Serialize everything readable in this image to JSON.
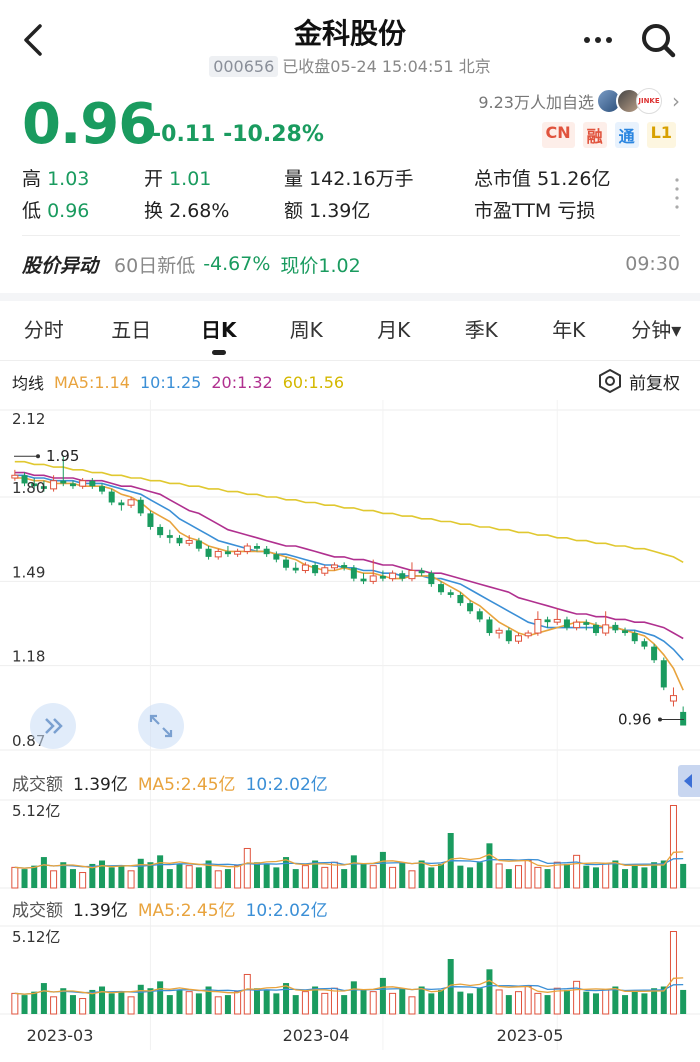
{
  "header": {
    "title": "金科股份",
    "code": "000656",
    "status": "已收盘05-24 15:04:51 北京"
  },
  "follow": {
    "text": "9.23万人加自选",
    "avatar3_text": "JINKE"
  },
  "quote": {
    "price": "0.96",
    "change": "-0.11",
    "change_pct": "-10.28%",
    "badges": [
      "CN",
      "融",
      "通",
      "L1"
    ]
  },
  "stats": {
    "high_label": "高",
    "high_value": "1.03",
    "open_label": "开",
    "open_value": "1.01",
    "vol_label": "量",
    "vol_value": "142.16万手",
    "mktcap_label": "总市值",
    "mktcap_value": "51.26亿",
    "low_label": "低",
    "low_value": "0.96",
    "turnover_label": "换",
    "turnover_value": "2.68%",
    "amount_label": "额",
    "amount_value": "1.39亿",
    "pe_label": "市盈TTM",
    "pe_value": "亏损"
  },
  "abnormal": {
    "label": "股价异动",
    "text": "60日新低",
    "pct": "-4.67%",
    "now": "现价1.02",
    "time": "09:30"
  },
  "tabs": [
    "分时",
    "五日",
    "日K",
    "周K",
    "月K",
    "季K",
    "年K",
    "分钟▾"
  ],
  "ma": {
    "label": "均线",
    "ma5": "MA5:1.14",
    "ma10": "10:1.25",
    "ma20": "20:1.32",
    "ma60": "60:1.56",
    "restore": "前复权",
    "colors": {
      "ma5": "#e8a33d",
      "ma10": "#3b8fd6",
      "ma20": "#b0308f",
      "ma60": "#e0c830"
    }
  },
  "colors": {
    "up": "#e0533d",
    "down": "#1a9b5f"
  },
  "volume": {
    "label": "成交额",
    "value": "1.39亿",
    "ma5": "MA5:2.45亿",
    "ma10": "10:2.02亿",
    "max_label": "5.12亿"
  },
  "chart_data": {
    "type": "candlestick",
    "y_ticks": [
      "2.12",
      "1.80",
      "1.49",
      "1.18",
      "0.87"
    ],
    "ylim": [
      0.87,
      2.12
    ],
    "high_mark": "1.95",
    "low_mark": "0.96",
    "x_ticks": [
      "2023-03",
      "2023-04",
      "2023-05"
    ],
    "candles": [
      [
        1.87,
        1.88,
        1.9,
        1.86
      ],
      [
        1.88,
        1.85,
        1.89,
        1.84
      ],
      [
        1.85,
        1.84,
        1.87,
        1.83
      ],
      [
        1.84,
        1.83,
        1.86,
        1.82
      ],
      [
        1.83,
        1.86,
        1.88,
        1.82
      ],
      [
        1.86,
        1.85,
        1.95,
        1.84
      ],
      [
        1.85,
        1.84,
        1.86,
        1.83
      ],
      [
        1.84,
        1.86,
        1.87,
        1.83
      ],
      [
        1.86,
        1.84,
        1.87,
        1.83
      ],
      [
        1.84,
        1.82,
        1.85,
        1.81
      ],
      [
        1.82,
        1.78,
        1.83,
        1.77
      ],
      [
        1.78,
        1.77,
        1.79,
        1.75
      ],
      [
        1.77,
        1.79,
        1.8,
        1.76
      ],
      [
        1.79,
        1.74,
        1.8,
        1.73
      ],
      [
        1.74,
        1.69,
        1.75,
        1.68
      ],
      [
        1.69,
        1.66,
        1.7,
        1.65
      ],
      [
        1.66,
        1.65,
        1.68,
        1.63
      ],
      [
        1.65,
        1.63,
        1.66,
        1.62
      ],
      [
        1.63,
        1.64,
        1.66,
        1.62
      ],
      [
        1.64,
        1.61,
        1.65,
        1.6
      ],
      [
        1.61,
        1.58,
        1.62,
        1.57
      ],
      [
        1.58,
        1.6,
        1.61,
        1.57
      ],
      [
        1.6,
        1.59,
        1.62,
        1.58
      ],
      [
        1.59,
        1.6,
        1.61,
        1.58
      ],
      [
        1.6,
        1.62,
        1.63,
        1.59
      ],
      [
        1.62,
        1.61,
        1.63,
        1.6
      ],
      [
        1.61,
        1.59,
        1.62,
        1.58
      ],
      [
        1.59,
        1.57,
        1.6,
        1.56
      ],
      [
        1.57,
        1.54,
        1.58,
        1.53
      ],
      [
        1.54,
        1.53,
        1.56,
        1.52
      ],
      [
        1.53,
        1.55,
        1.56,
        1.52
      ],
      [
        1.55,
        1.52,
        1.56,
        1.51
      ],
      [
        1.52,
        1.54,
        1.55,
        1.51
      ],
      [
        1.54,
        1.55,
        1.56,
        1.53
      ],
      [
        1.55,
        1.54,
        1.56,
        1.53
      ],
      [
        1.54,
        1.5,
        1.55,
        1.49
      ],
      [
        1.5,
        1.49,
        1.52,
        1.48
      ],
      [
        1.49,
        1.51,
        1.57,
        1.48
      ],
      [
        1.51,
        1.5,
        1.53,
        1.49
      ],
      [
        1.5,
        1.52,
        1.53,
        1.49
      ],
      [
        1.52,
        1.5,
        1.53,
        1.49
      ],
      [
        1.5,
        1.53,
        1.56,
        1.49
      ],
      [
        1.53,
        1.52,
        1.54,
        1.51
      ],
      [
        1.52,
        1.48,
        1.53,
        1.47
      ],
      [
        1.48,
        1.45,
        1.49,
        1.44
      ],
      [
        1.45,
        1.44,
        1.46,
        1.43
      ],
      [
        1.44,
        1.41,
        1.45,
        1.4
      ],
      [
        1.41,
        1.38,
        1.42,
        1.37
      ],
      [
        1.38,
        1.35,
        1.39,
        1.34
      ],
      [
        1.35,
        1.3,
        1.36,
        1.29
      ],
      [
        1.3,
        1.31,
        1.32,
        1.28
      ],
      [
        1.31,
        1.27,
        1.32,
        1.26
      ],
      [
        1.27,
        1.29,
        1.3,
        1.26
      ],
      [
        1.29,
        1.3,
        1.31,
        1.28
      ],
      [
        1.3,
        1.35,
        1.38,
        1.29
      ],
      [
        1.35,
        1.34,
        1.36,
        1.32
      ],
      [
        1.34,
        1.35,
        1.39,
        1.33
      ],
      [
        1.35,
        1.32,
        1.36,
        1.31
      ],
      [
        1.32,
        1.34,
        1.35,
        1.31
      ],
      [
        1.34,
        1.33,
        1.35,
        1.31
      ],
      [
        1.33,
        1.3,
        1.34,
        1.29
      ],
      [
        1.3,
        1.33,
        1.38,
        1.29
      ],
      [
        1.33,
        1.31,
        1.34,
        1.3
      ],
      [
        1.31,
        1.3,
        1.32,
        1.29
      ],
      [
        1.3,
        1.27,
        1.31,
        1.26
      ],
      [
        1.27,
        1.25,
        1.28,
        1.24
      ],
      [
        1.25,
        1.2,
        1.26,
        1.19
      ],
      [
        1.2,
        1.1,
        1.21,
        1.09
      ],
      [
        1.05,
        1.07,
        1.1,
        1.03
      ],
      [
        1.01,
        0.96,
        1.03,
        0.96
      ]
    ],
    "ma5": [
      1.87,
      1.87,
      1.86,
      1.86,
      1.85,
      1.85,
      1.85,
      1.84,
      1.84,
      1.84,
      1.83,
      1.81,
      1.8,
      1.78,
      1.75,
      1.73,
      1.71,
      1.67,
      1.65,
      1.64,
      1.62,
      1.61,
      1.6,
      1.6,
      1.6,
      1.6,
      1.6,
      1.59,
      1.58,
      1.57,
      1.55,
      1.54,
      1.53,
      1.53,
      1.54,
      1.53,
      1.52,
      1.52,
      1.51,
      1.5,
      1.5,
      1.51,
      1.51,
      1.51,
      1.49,
      1.47,
      1.45,
      1.42,
      1.4,
      1.37,
      1.34,
      1.32,
      1.3,
      1.29,
      1.3,
      1.31,
      1.32,
      1.33,
      1.34,
      1.34,
      1.33,
      1.32,
      1.32,
      1.31,
      1.3,
      1.29,
      1.26,
      1.22,
      1.17,
      1.09
    ],
    "ma10": [
      1.88,
      1.88,
      1.87,
      1.87,
      1.86,
      1.86,
      1.86,
      1.85,
      1.85,
      1.85,
      1.84,
      1.83,
      1.82,
      1.81,
      1.79,
      1.77,
      1.75,
      1.72,
      1.7,
      1.68,
      1.66,
      1.64,
      1.63,
      1.62,
      1.61,
      1.6,
      1.6,
      1.59,
      1.59,
      1.58,
      1.57,
      1.56,
      1.55,
      1.55,
      1.54,
      1.54,
      1.53,
      1.53,
      1.52,
      1.52,
      1.51,
      1.51,
      1.51,
      1.5,
      1.5,
      1.49,
      1.48,
      1.46,
      1.44,
      1.42,
      1.4,
      1.38,
      1.36,
      1.34,
      1.33,
      1.32,
      1.32,
      1.32,
      1.32,
      1.32,
      1.32,
      1.32,
      1.32,
      1.31,
      1.31,
      1.3,
      1.29,
      1.27,
      1.24,
      1.2
    ],
    "ma20": [
      1.89,
      1.89,
      1.88,
      1.88,
      1.87,
      1.87,
      1.87,
      1.86,
      1.86,
      1.86,
      1.85,
      1.84,
      1.84,
      1.83,
      1.82,
      1.81,
      1.79,
      1.77,
      1.75,
      1.74,
      1.72,
      1.7,
      1.68,
      1.67,
      1.66,
      1.65,
      1.64,
      1.63,
      1.62,
      1.62,
      1.61,
      1.6,
      1.59,
      1.58,
      1.58,
      1.57,
      1.57,
      1.56,
      1.55,
      1.55,
      1.54,
      1.53,
      1.53,
      1.52,
      1.52,
      1.51,
      1.5,
      1.49,
      1.48,
      1.47,
      1.46,
      1.45,
      1.43,
      1.42,
      1.41,
      1.4,
      1.39,
      1.38,
      1.37,
      1.37,
      1.36,
      1.36,
      1.35,
      1.35,
      1.34,
      1.34,
      1.33,
      1.32,
      1.3,
      1.28
    ],
    "ma60": [
      1.93,
      1.93,
      1.92,
      1.92,
      1.91,
      1.91,
      1.9,
      1.9,
      1.89,
      1.89,
      1.88,
      1.88,
      1.87,
      1.87,
      1.86,
      1.86,
      1.85,
      1.85,
      1.84,
      1.84,
      1.83,
      1.83,
      1.82,
      1.82,
      1.81,
      1.81,
      1.8,
      1.8,
      1.79,
      1.79,
      1.78,
      1.78,
      1.77,
      1.77,
      1.76,
      1.76,
      1.75,
      1.75,
      1.74,
      1.74,
      1.73,
      1.73,
      1.72,
      1.72,
      1.71,
      1.71,
      1.7,
      1.7,
      1.69,
      1.69,
      1.68,
      1.68,
      1.67,
      1.67,
      1.66,
      1.66,
      1.65,
      1.65,
      1.64,
      1.64,
      1.63,
      1.63,
      1.62,
      1.62,
      1.61,
      1.61,
      1.6,
      1.59,
      1.58,
      1.56
    ],
    "turnover_yi": [
      1.2,
      1.1,
      1.3,
      1.8,
      1.0,
      1.5,
      1.1,
      0.9,
      1.4,
      1.6,
      1.2,
      1.3,
      1.0,
      1.7,
      1.5,
      1.9,
      1.1,
      1.4,
      1.3,
      1.2,
      1.6,
      1.0,
      1.1,
      1.3,
      2.3,
      1.5,
      1.4,
      1.2,
      1.8,
      1.1,
      1.3,
      1.6,
      1.2,
      1.5,
      1.1,
      1.9,
      1.4,
      1.3,
      2.1,
      1.2,
      1.5,
      1.0,
      1.6,
      1.2,
      1.4,
      3.2,
      1.3,
      1.2,
      1.5,
      2.6,
      1.4,
      1.1,
      1.3,
      1.6,
      1.2,
      1.1,
      1.5,
      1.4,
      1.9,
      1.3,
      1.2,
      1.4,
      1.6,
      1.1,
      1.3,
      1.2,
      1.5,
      1.6,
      4.8,
      1.4
    ]
  }
}
